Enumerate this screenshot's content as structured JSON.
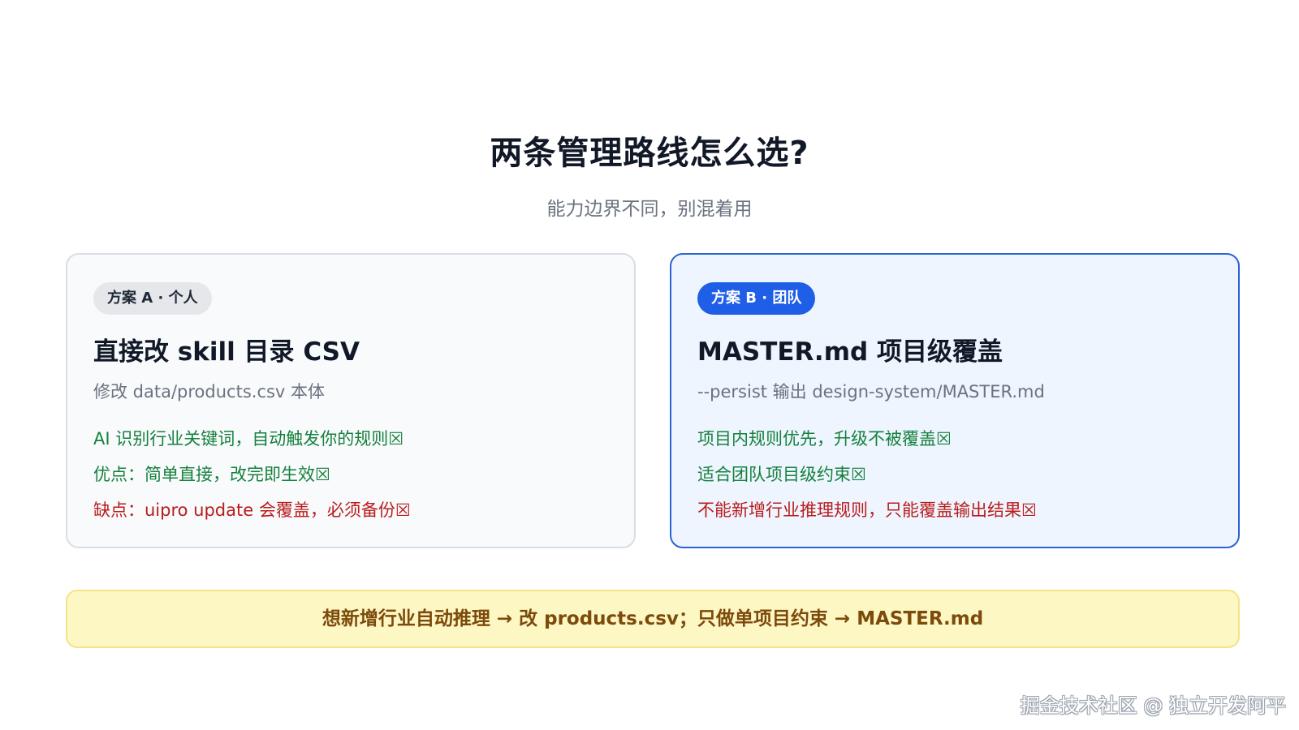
{
  "header": {
    "title": "两条管理路线怎么选?",
    "subtitle": "能力边界不同，别混着用"
  },
  "plan_a": {
    "badge": "方案 A · 个人",
    "title": "直接改 skill 目录 CSV",
    "desc": "修改 data/products.csv 本体",
    "points": [
      {
        "text": "AI 识别行业关键词，自动触发你的规则☒",
        "tone": "positive"
      },
      {
        "text": "优点：简单直接，改完即生效☒",
        "tone": "positive"
      },
      {
        "text": "缺点：uipro update 会覆盖，必须备份☒",
        "tone": "negative"
      }
    ]
  },
  "plan_b": {
    "badge": "方案 B · 团队",
    "title": "MASTER.md 项目级覆盖",
    "desc": "--persist 输出 design-system/MASTER.md",
    "points": [
      {
        "text": "项目内规则优先，升级不被覆盖☒",
        "tone": "positive"
      },
      {
        "text": "适合团队项目级约束☒",
        "tone": "positive"
      },
      {
        "text": "不能新增行业推理规则，只能覆盖输出结果☒",
        "tone": "negative"
      }
    ]
  },
  "tip": {
    "text": "想新增行业自动推理 → 改 products.csv；只做单项目约束 → MASTER.md"
  },
  "watermark": {
    "text": "掘金技术社区 @ 独立开发阿平"
  },
  "colors": {
    "accent": "#1f5ee6",
    "positive": "#15803d",
    "negative": "#b91c1c",
    "tip_background": "#fdf7c3",
    "tip_text": "#7c4a0b"
  }
}
